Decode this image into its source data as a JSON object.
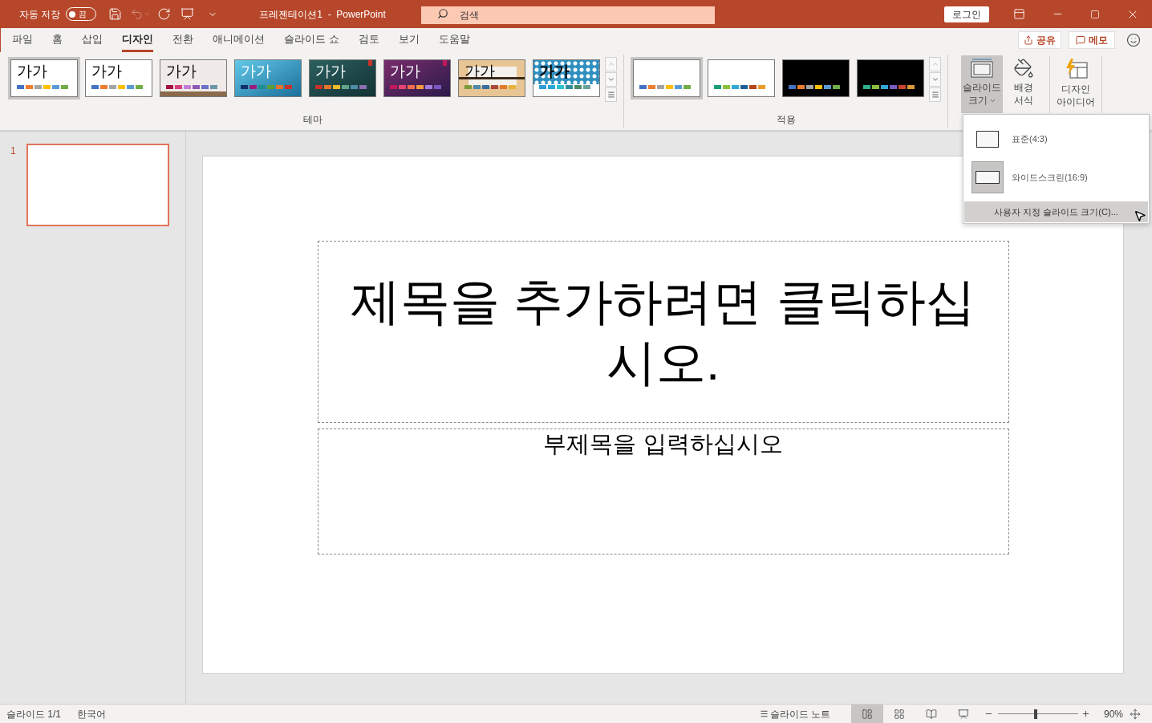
{
  "title_bar": {
    "autosave_label": "자동 저장",
    "autosave": {
      "on": false,
      "state_text": "끔"
    },
    "undo_disabled": true,
    "document_title": "프레젠테이션1  -  PowerPoint",
    "search": {
      "placeholder": "검색"
    },
    "login": "로그인"
  },
  "tabs": [
    {
      "label": "파일",
      "selected": false
    },
    {
      "label": "홈",
      "selected": false
    },
    {
      "label": "삽입",
      "selected": false
    },
    {
      "label": "디자인",
      "selected": true
    },
    {
      "label": "전환",
      "selected": false
    },
    {
      "label": "애니메이션",
      "selected": false
    },
    {
      "label": "슬라이드 쇼",
      "selected": false
    },
    {
      "label": "검토",
      "selected": false
    },
    {
      "label": "보기",
      "selected": false
    },
    {
      "label": "도움말",
      "selected": false
    }
  ],
  "share_button": "공유",
  "comments_button": "메모",
  "ribbon": {
    "themes": {
      "label": "테마",
      "items": [
        {
          "kind": "office",
          "text": "가가",
          "selected": true
        },
        {
          "kind": "office2",
          "text": "가가",
          "selected": false
        },
        {
          "kind": "paper",
          "text": "가가",
          "selected": false
        },
        {
          "kind": "blue",
          "text": "가가",
          "selected": false
        },
        {
          "kind": "teal",
          "text": "가가",
          "selected": false
        },
        {
          "kind": "purple",
          "text": "가가",
          "selected": false
        },
        {
          "kind": "wood",
          "text": "가가",
          "selected": false
        },
        {
          "kind": "pattern",
          "text": "가가",
          "selected": false
        }
      ]
    },
    "variants": {
      "label": "적용",
      "items": [
        {
          "kind": "light",
          "selected": true
        },
        {
          "kind": "light2",
          "selected": false
        },
        {
          "kind": "dark",
          "selected": false
        },
        {
          "kind": "dark2",
          "selected": false
        }
      ]
    },
    "buttons": [
      {
        "kind": "slide-size",
        "label": "슬라이드 크기",
        "expanded": true
      },
      {
        "kind": "background",
        "label": "배경 서식",
        "expanded": false
      },
      {
        "kind": "ideas",
        "label": "디자인 아이디어",
        "expanded": false
      }
    ]
  },
  "slide_size_menu": {
    "items": [
      {
        "kind": "standard",
        "label": "표준(4:3)",
        "selected": false
      },
      {
        "kind": "wide",
        "label": "와이드스크린(16:9)",
        "selected": true
      }
    ],
    "custom": "사용자 지정 슬라이드 크기(C)..."
  },
  "thumbnails": [
    {
      "number": "1",
      "selected": true
    }
  ],
  "slide": {
    "title": "제목을 추가하려면 클릭하십시오.",
    "subtitle": "부제목을 입력하십시오"
  },
  "status_bar": {
    "slide": "슬라이드 1/1",
    "language": "한국어",
    "notes": "슬라이드 노트",
    "views": [
      {
        "kind": "normal",
        "selected": true
      },
      {
        "kind": "sorter",
        "selected": false
      },
      {
        "kind": "reading",
        "selected": false
      },
      {
        "kind": "show",
        "selected": false
      }
    ],
    "zoom": {
      "level": 0.45,
      "reading": "90%"
    }
  }
}
